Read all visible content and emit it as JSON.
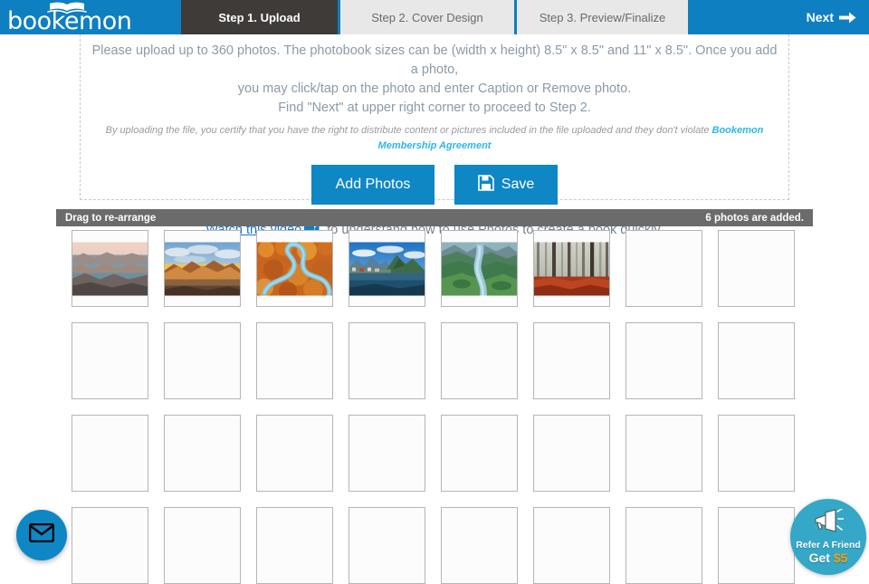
{
  "header": {
    "logo_text": "bookemon",
    "logo_icon": "open-book-icon",
    "tabs": [
      {
        "label": "Step 1. Upload",
        "active": true
      },
      {
        "label": "Step 2. Cover Design",
        "active": false
      },
      {
        "label": "Step 3. Preview/Finalize",
        "active": false
      }
    ],
    "next_label": "Next",
    "next_icon": "arrow-right-icon",
    "brand_color": "#0e7fc0",
    "active_tab_color": "#3e3b39"
  },
  "upload_panel": {
    "instructions": [
      "Please upload up to 360 photos. The photobook sizes can be (width x height) 8.5\" x 8.5\" and 11\" x 8.5\". Once you add a photo,",
      "you may click/tap on the photo and enter Caption or Remove photo.",
      "Find \"Next\" at upper right corner to proceed to Step 2."
    ],
    "disclaimer_prefix": "By uploading the file, you certify that you have the right to distribute content or pictures included in the file uploaded and they don't violate ",
    "disclaimer_link": "Bookemon Membership Agreement",
    "add_photos_label": "Add Photos",
    "save_label": "Save",
    "save_icon": "floppy-disk-icon",
    "video_link_label": "Watch this video",
    "video_icon": "video-camera-icon",
    "video_text_after": " to understand how to use Photos to create a book quickly.",
    "button_color": "#0e87c4"
  },
  "drag_bar": {
    "left_label": "Drag to re-arrange",
    "right_label": "6 photos are added.",
    "background": "#6b6b6b"
  },
  "grid": {
    "columns": 8,
    "rows": 4,
    "total_cells": 32,
    "photo_count": 6,
    "photos": [
      {
        "index": 1,
        "name": "lake-powell-canyon-sunset"
      },
      {
        "index": 2,
        "name": "golden-mountain-range-clouds"
      },
      {
        "index": 3,
        "name": "aerial-winding-river-autumn"
      },
      {
        "index": 4,
        "name": "lofoten-village-fjord-blue-sky"
      },
      {
        "index": 5,
        "name": "green-valley-river-aerial"
      },
      {
        "index": 6,
        "name": "autumn-forest-red-leaves-fog"
      }
    ]
  },
  "widgets": {
    "mail_fab_icon": "envelope-icon",
    "mail_fab_color": "#0e87c4",
    "refer_icon": "megaphone-icon",
    "refer_line1": "Refer A Friend",
    "refer_get": "Get ",
    "refer_amount": "$5",
    "refer_color": "#34a8c6",
    "refer_amount_color": "#f0a018"
  }
}
